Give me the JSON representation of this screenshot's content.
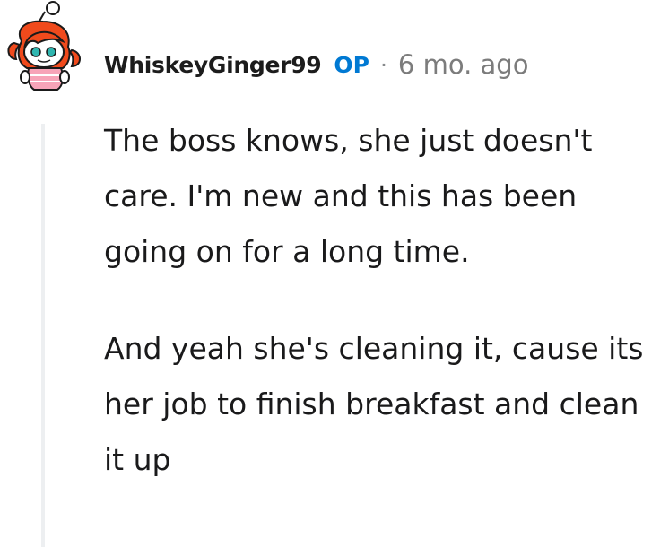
{
  "comment": {
    "username": "WhiskeyGinger99",
    "op_label": "OP",
    "separator": "·",
    "timestamp": "6 mo. ago",
    "avatar_icon": "snoo-avatar-icon",
    "paragraphs": [
      "The boss knows, she just doesn't care. I'm new and this has been going on for a long time.",
      "And yeah she's cleaning it, cause its her job to finish breakfast and clean it up"
    ]
  },
  "colors": {
    "op": "#0079d3",
    "username": "#1c1c1c",
    "meta": "#7c7c7c",
    "thread_line": "#edeff1",
    "avatar_hair": "#f04a1c",
    "avatar_eyes": "#2fb6b0",
    "avatar_shirt": "#f7a4b8"
  }
}
